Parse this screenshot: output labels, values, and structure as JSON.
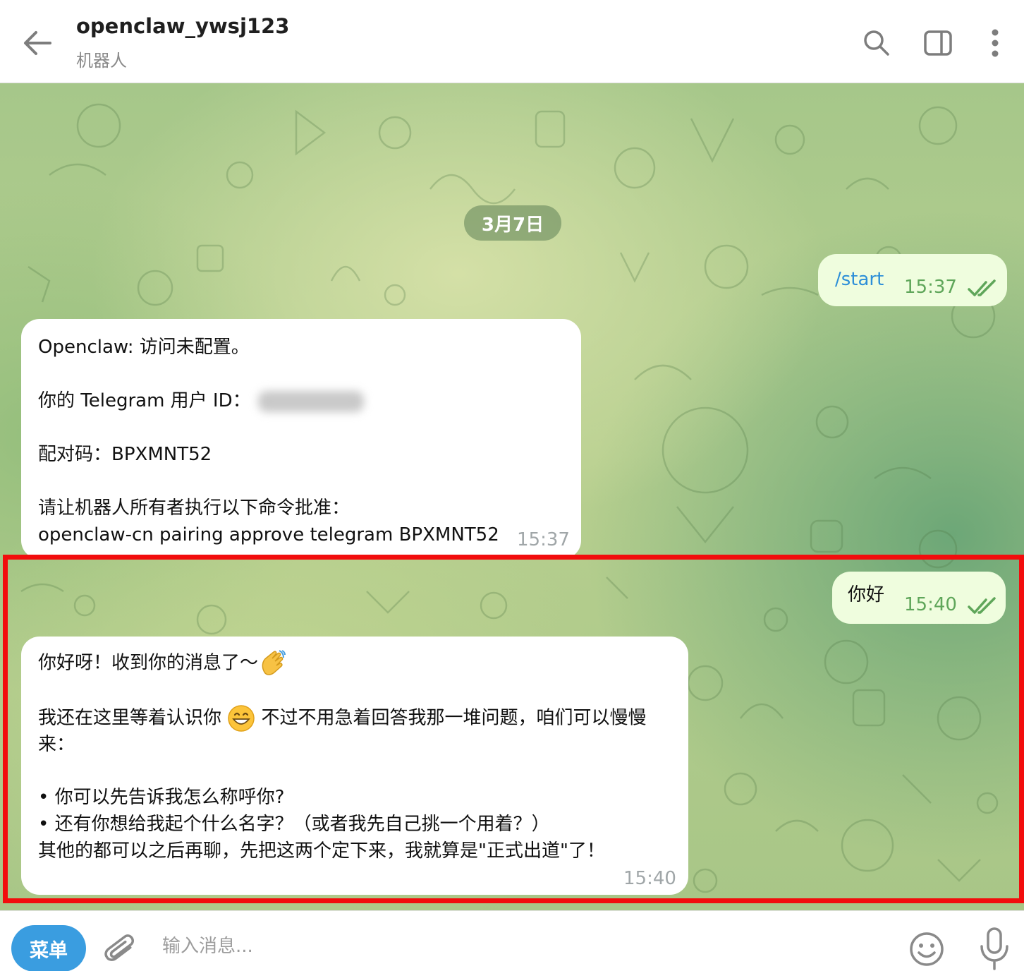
{
  "header": {
    "title": "openclaw_ywsj123",
    "subtitle": "机器人"
  },
  "chat": {
    "date_label": "3月7日",
    "messages": [
      {
        "direction": "outgoing",
        "text": "/start",
        "time": "15:37",
        "read": true
      },
      {
        "direction": "incoming",
        "lines": [
          "Openclaw: 访问未配置。",
          "",
          "你的 Telegram 用户 ID：",
          "",
          "配对码：BPXMNT52",
          "",
          "请让机器人所有者执行以下命令批准：",
          "openclaw-cn pairing approve telegram BPXMNT52"
        ],
        "time": "15:37"
      },
      {
        "direction": "outgoing",
        "text": "你好",
        "time": "15:40",
        "read": true
      },
      {
        "direction": "incoming",
        "lines": [
          "你好呀！收到你的消息了～",
          "",
          "我还在这里等着认识你",
          "不过不用急着回答我那一堆问题，咱们可以慢慢",
          "来：",
          "",
          "• 你可以先告诉我怎么称呼你?",
          "• 还有你想给我起个什么名字？（或者我先自己挑一个用着？）",
          "其他的都可以之后再聊，先把这两个定下来，我就算是\"正式出道\"了！"
        ],
        "emojis": [
          "waving-hand",
          "grinning-face"
        ],
        "time": "15:40"
      }
    ]
  },
  "input": {
    "menu_label": "菜单",
    "placeholder": "输入消息..."
  },
  "colors": {
    "outgoing_bubble": "#effdde",
    "outgoing_time": "#5fa65a",
    "incoming_time": "#a0a6a8",
    "menu_button": "#3a9de0",
    "highlight_box": "#f20d0d"
  },
  "icons": [
    "back-arrow-icon",
    "search-icon",
    "sidebar-toggle-icon",
    "more-vertical-icon",
    "paperclip-icon",
    "emoji-icon",
    "microphone-icon",
    "double-check-icon"
  ]
}
